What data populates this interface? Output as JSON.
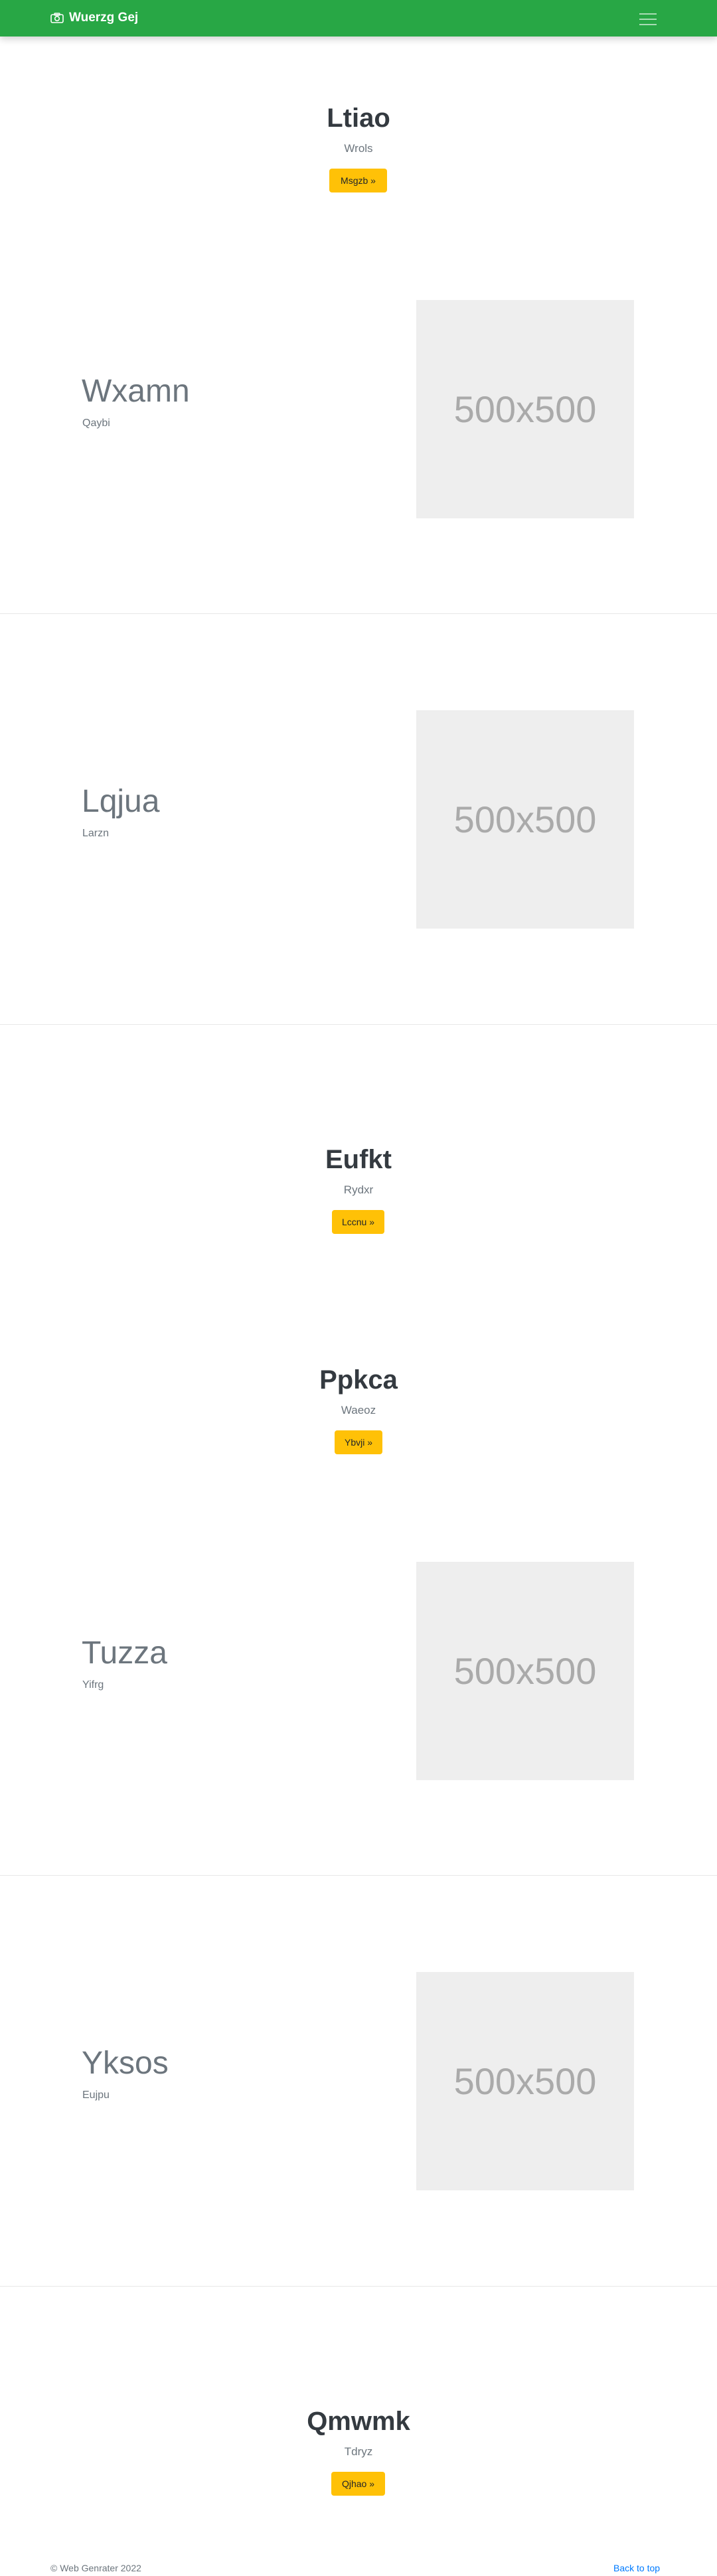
{
  "navbar": {
    "brand": "Wuerzg Gej",
    "brand_icon": "camera-icon",
    "toggler_icon": "hamburger-menu-icon",
    "color": "#28a745"
  },
  "hero1": {
    "title": "Ltiao",
    "subtitle": "Wrols",
    "button": "Msgzb »"
  },
  "feature1": {
    "title": "Wxamn",
    "subtitle": "Qaybi",
    "image_text": "500x500"
  },
  "feature2": {
    "title": "Lqjua",
    "subtitle": "Larzn",
    "image_text": "500x500"
  },
  "hero2": {
    "title": "Eufkt",
    "subtitle": "Rydxr",
    "button": "Lccnu »"
  },
  "hero3": {
    "title": "Ppkca",
    "subtitle": "Waeoz",
    "button": "Ybvji »"
  },
  "feature3": {
    "title": "Tuzza",
    "subtitle": "Yifrg",
    "image_text": "500x500"
  },
  "feature4": {
    "title": "Yksos",
    "subtitle": "Eujpu",
    "image_text": "500x500"
  },
  "hero4": {
    "title": "Qmwmk",
    "subtitle": "Tdryz",
    "button": "Qjhao »"
  },
  "footer": {
    "copyright": "© Web Genrater 2022",
    "back_to_top": "Back to top"
  },
  "colors": {
    "accent_button": "#ffc107",
    "link": "#007bff",
    "placeholder_bg": "#eeeeee"
  }
}
